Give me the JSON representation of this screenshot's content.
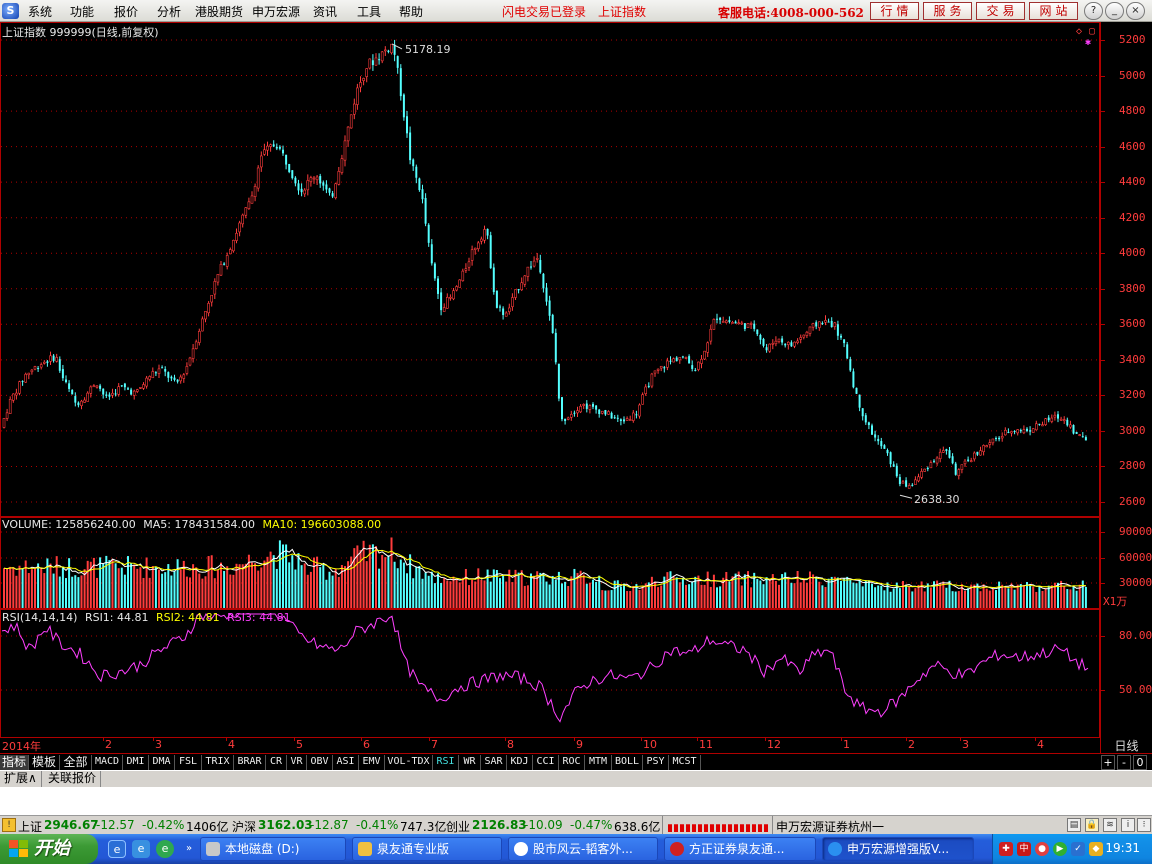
{
  "menubar": {
    "logo_glyph": "S",
    "items": [
      "系统",
      "功能",
      "报价",
      "分析",
      "港股期货",
      "申万宏源",
      "资讯",
      "工具",
      "帮助"
    ],
    "login_status": "闪电交易已登录",
    "current_index": "上证指数",
    "hotline": "客服电话:4008-000-562",
    "buttons": [
      "行情",
      "服务",
      "交易",
      "网站"
    ],
    "window_controls": [
      "?",
      "_",
      "□",
      "×"
    ]
  },
  "chart": {
    "title": "上证指数 999999(日线,前复权)",
    "high_label": "5178.19",
    "low_label": "2638.30",
    "price_ticks": [
      "5200",
      "5000",
      "4800",
      "4600",
      "4400",
      "4200",
      "4000",
      "3800",
      "3600",
      "3400",
      "3200",
      "3000",
      "2800",
      "2600"
    ],
    "volume_info": {
      "label": "VOLUME: 125856240.00",
      "ma5": "MA5: 178431584.00",
      "ma10": "MA10: 196603088.00"
    },
    "volume_ticks": [
      "90000",
      "60000",
      "30000"
    ],
    "volume_unit": "X1万",
    "rsi_info": {
      "label": "RSI(14,14,14)",
      "rsi1": "RSI1: 44.81",
      "rsi2": "RSI2: 44.81",
      "rsi3": "RSI3: 44.81"
    },
    "rsi_ticks": [
      "80.00",
      "50.00"
    ],
    "x_labels": [
      "2014年",
      "2",
      "3",
      "4",
      "5",
      "6",
      "7",
      "8",
      "9",
      "10",
      "11",
      "12",
      "1",
      "2",
      "3",
      "4"
    ],
    "period": "日线",
    "colors": {
      "up": "#ff3c3c",
      "down": "#54ffff",
      "ma5": "#ffffff",
      "ma10": "#ffff00",
      "rsi": "#ff40ff",
      "grid": "#b00000"
    }
  },
  "chart_data": {
    "type": "candlestick",
    "series": [
      {
        "name": "上证指数",
        "values": [
          3050,
          3180,
          3360,
          3150,
          3290,
          3420,
          3900,
          4400,
          4520,
          4200,
          5178.19,
          4380,
          3820,
          3960,
          4010,
          3600,
          3800,
          3100,
          3050,
          3250,
          3450,
          3650,
          3580,
          3680,
          3500,
          2900,
          2638.3,
          2900,
          2950,
          3000,
          3080,
          3100,
          3040,
          2946.67
        ]
      }
    ],
    "price_range": [
      2600,
      5200
    ]
  },
  "tabs": {
    "items": [
      "指标",
      "模板",
      "全部",
      "MACD",
      "DMI",
      "DMA",
      "FSL",
      "TRIX",
      "BRAR",
      "CR",
      "VR",
      "OBV",
      "ASI",
      "EMV",
      "VOL-TDX",
      "RSI",
      "WR",
      "SAR",
      "KDJ",
      "CCI",
      "ROC",
      "MTM",
      "BOLL",
      "PSY",
      "MCST"
    ],
    "controls": [
      "+",
      "-",
      "0"
    ]
  },
  "ext_tabs": [
    "扩展∧",
    "关联报价"
  ],
  "status": {
    "sh_label": "上证",
    "sh_value": "2946.67",
    "sh_change": "-12.57",
    "sh_pct": "-0.42%",
    "sh_amount": "1406亿",
    "hs_label": "沪深",
    "hs_value": "3162.03",
    "hs_change": "-12.87",
    "hs_pct": "-0.41%",
    "hs_amount": "747.3亿",
    "cy_label": "创业",
    "cy_value": "2126.83",
    "cy_change": "-10.09",
    "cy_pct": "-0.47%",
    "cy_amount": "638.6亿",
    "broker": "申万宏源证券杭州一"
  },
  "taskbar": {
    "start_label": "开始",
    "tasks": [
      "本地磁盘 (D:)",
      "泉友通专业版",
      "股市风云-韬客外...",
      "方正证券泉友通...",
      "申万宏源增强版V..."
    ],
    "clock": "19:31"
  }
}
